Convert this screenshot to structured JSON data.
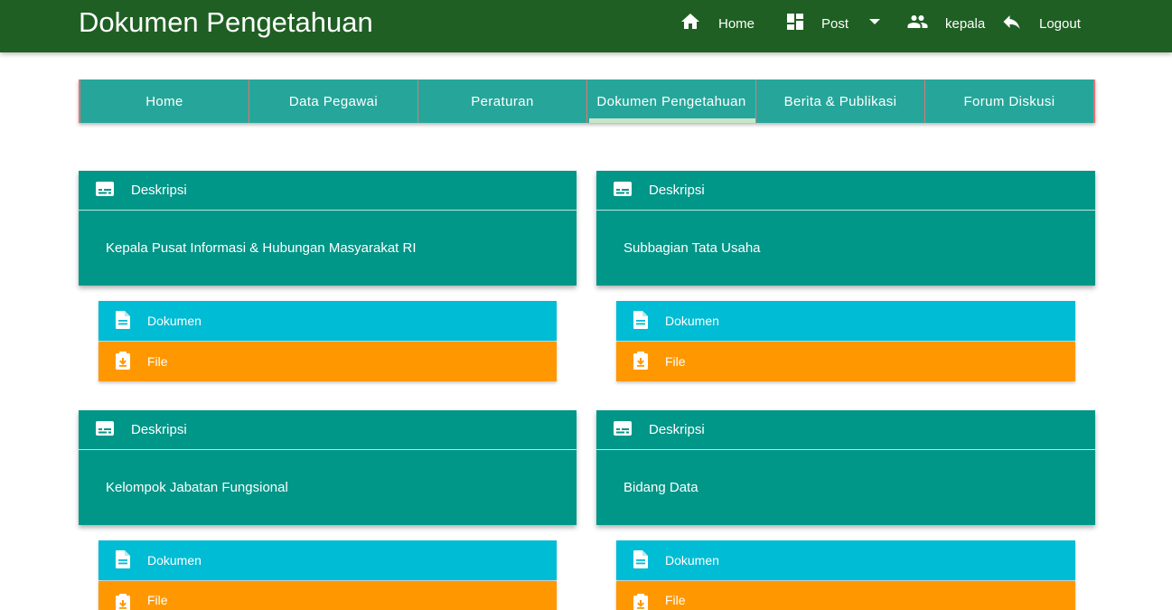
{
  "header": {
    "title": "Dokumen Pengetahuan",
    "nav": {
      "home": "Home",
      "post": "Post",
      "user": "kepala",
      "logout": "Logout"
    }
  },
  "tabs": [
    "Home",
    "Data Pegawai",
    "Peraturan",
    "Dokumen Pengetahuan",
    "Berita & Publikasi",
    "Forum Diskusi"
  ],
  "active_tab": "Dokumen Pengetahuan",
  "cards": [
    {
      "heading": "Deskripsi",
      "description": "Kepala Pusat Informasi & Hubungan Masyarakat RI",
      "dokumen_label": "Dokumen",
      "file_label": "File"
    },
    {
      "heading": "Deskripsi",
      "description": "Subbagian Tata Usaha",
      "dokumen_label": "Dokumen",
      "file_label": "File"
    },
    {
      "heading": "Deskripsi",
      "description": "Kelompok Jabatan Fungsional",
      "dokumen_label": "Dokumen",
      "file_label": "File"
    },
    {
      "heading": "Deskripsi",
      "description": "Bidang Data",
      "dokumen_label": "Dokumen",
      "file_label": "File"
    }
  ],
  "colors": {
    "topbar": "#1f5f23",
    "tab_bar": "#26a69a",
    "tab_divider": "#e57373",
    "card": "#009688",
    "dokumen_button": "#00bcd4",
    "file_button": "#ff9800"
  },
  "icons": {
    "home": "home-icon",
    "post": "dashboard-icon",
    "dropdown": "caret-down-icon",
    "user": "people-icon",
    "logout": "reply-icon",
    "deskripsi": "subtitles-icon",
    "dokumen": "description-icon",
    "file": "clipboard-download-icon"
  }
}
